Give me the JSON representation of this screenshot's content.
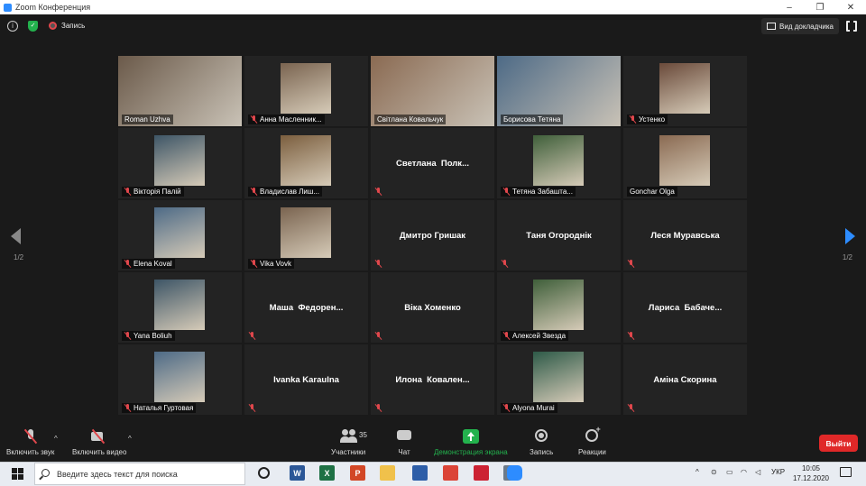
{
  "window": {
    "title": "Zoom Конференция"
  },
  "window_controls": {
    "minimize": "–",
    "maximize": "❐",
    "close": "✕"
  },
  "topbar": {
    "info": "i",
    "shield": "✓",
    "recording_label": "Запись",
    "speaker_view_label": "Вид докладчика"
  },
  "tiles": [
    {
      "name": "Roman Uzhva",
      "kind": "video",
      "active": true,
      "muted": false
    },
    {
      "name": "Анна Масленник...",
      "kind": "avatar",
      "muted": true
    },
    {
      "name": "Світлана Ковальчук",
      "kind": "video",
      "muted": false
    },
    {
      "name": "Борисова Тетяна",
      "kind": "video",
      "muted": false
    },
    {
      "name": "Устенко",
      "kind": "avatar",
      "muted": true
    },
    {
      "name": "Вікторія Палій",
      "kind": "avatar",
      "muted": true
    },
    {
      "name": "Владислав Лиш...",
      "kind": "avatar",
      "muted": true
    },
    {
      "center": "Светлана  Полк...",
      "kind": "text",
      "muted": true
    },
    {
      "name": "Тетяна Забашта...",
      "kind": "avatar",
      "muted": true
    },
    {
      "name": "Gonchar Olga",
      "kind": "avatar",
      "muted": false
    },
    {
      "name": "Elena Koval",
      "kind": "avatar",
      "muted": true
    },
    {
      "name": "Vika Vovk",
      "kind": "avatar",
      "muted": true
    },
    {
      "center": "Дмитро Гришак",
      "kind": "text",
      "muted": true
    },
    {
      "center": "Таня Огороднік",
      "kind": "text",
      "muted": true
    },
    {
      "center": "Леся Муравська",
      "kind": "text",
      "muted": true
    },
    {
      "name": "Yana Boliuh",
      "kind": "avatar",
      "muted": true
    },
    {
      "center": "Маша  Федорен...",
      "kind": "text",
      "muted": true
    },
    {
      "center": "Віка Хоменко",
      "kind": "text",
      "muted": true
    },
    {
      "name": "Алексей Звезда",
      "kind": "avatar",
      "muted": true
    },
    {
      "center": "Лариса  Бабаче...",
      "kind": "text",
      "muted": true
    },
    {
      "name": "Наталья Гуртовая",
      "kind": "avatar",
      "muted": true
    },
    {
      "center": "Ivanka Karaulna",
      "kind": "text",
      "muted": true
    },
    {
      "center": "Илона  Ковален...",
      "kind": "text",
      "muted": true
    },
    {
      "name": "Alyona Murai",
      "kind": "avatar",
      "muted": true
    },
    {
      "center": "Аміна Скорина",
      "kind": "text",
      "muted": true
    }
  ],
  "pagination": {
    "left": "1/2",
    "right": "1/2"
  },
  "toolbar": {
    "mute_label": "Включить звук",
    "video_label": "Включить видео",
    "participants_label": "Участники",
    "participants_count": "35",
    "chat_label": "Чат",
    "share_label": "Демонстрация экрана",
    "record_label": "Запись",
    "reactions_label": "Реакции",
    "leave_label": "Выйти",
    "caret": "^"
  },
  "taskbar": {
    "search_placeholder": "Введите здесь текст для поиска",
    "apps": [
      {
        "icon": "word-icon",
        "glyph": "W",
        "color": "#2b5797"
      },
      {
        "icon": "excel-icon",
        "glyph": "X",
        "color": "#1e7145"
      },
      {
        "icon": "powerpoint-icon",
        "glyph": "P",
        "color": "#d24726"
      },
      {
        "icon": "folder-icon",
        "glyph": "",
        "color": "#f0c14b"
      },
      {
        "icon": "save-icon",
        "glyph": "",
        "color": "#2d5ea8"
      },
      {
        "icon": "chrome-icon",
        "glyph": "",
        "color": "#db4437"
      },
      {
        "icon": "yandex-icon",
        "glyph": "",
        "color": "#cc2233"
      },
      {
        "icon": "unknown-app-icon",
        "glyph": "",
        "color": "#6c7a89"
      },
      {
        "icon": "zoom-icon",
        "glyph": "",
        "color": "#2d8cff"
      }
    ],
    "tray": {
      "caret": "^",
      "lang": "УКР"
    },
    "clock_time": "10:05",
    "clock_date": "17.12.2020"
  },
  "colors": {
    "active_border": "#c8e866",
    "muted_red": "#e0474c",
    "share_green": "#23b14d",
    "leave_red": "#e02828",
    "zoom_blue": "#2d8cff"
  }
}
